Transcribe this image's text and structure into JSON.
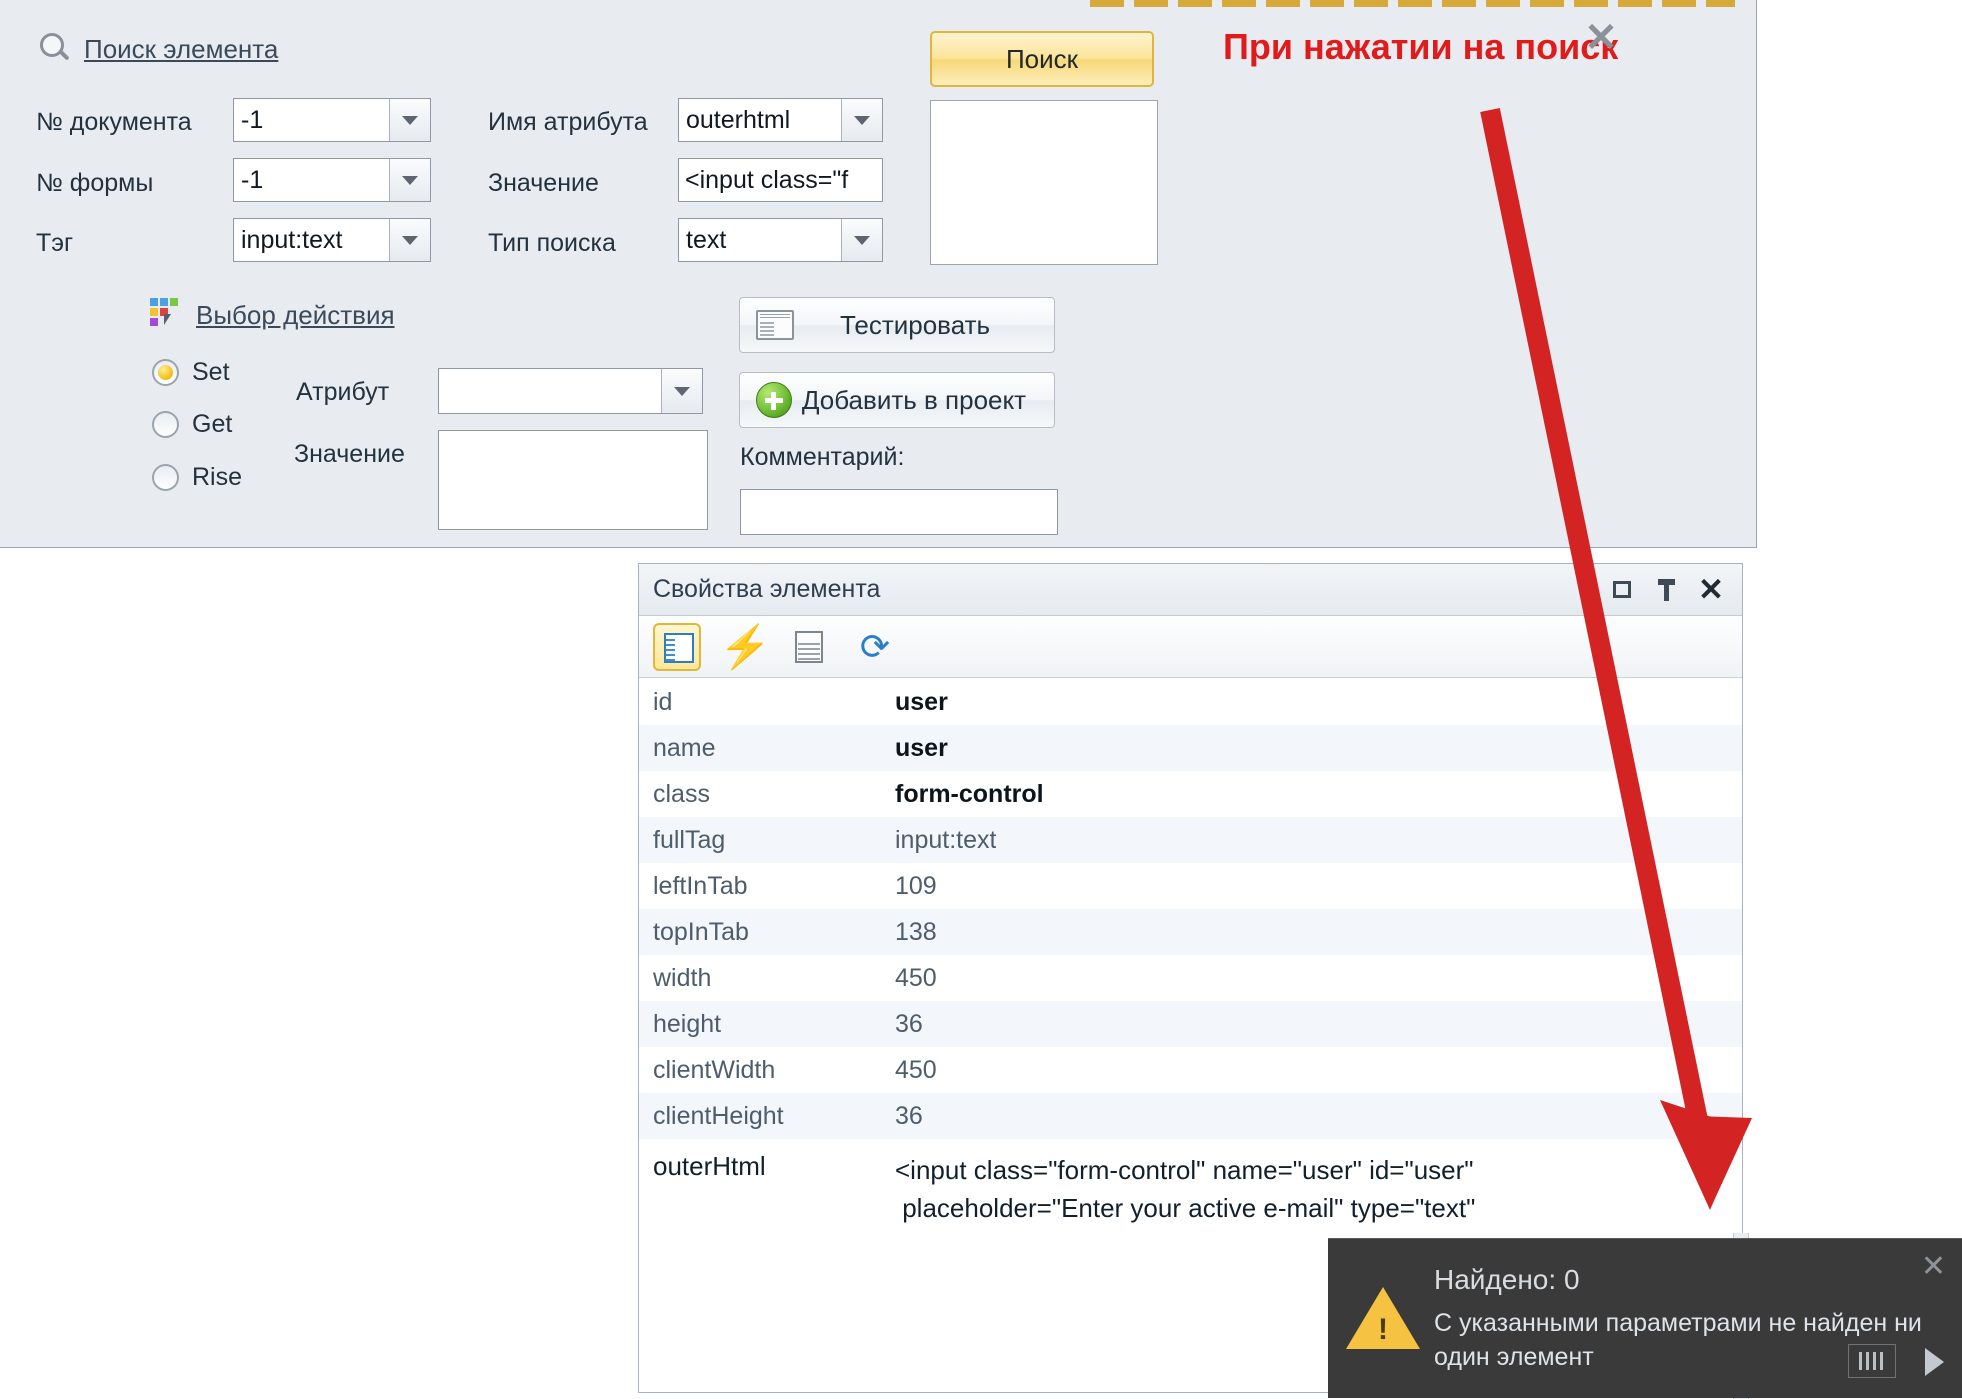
{
  "search_panel": {
    "title_link": "Поиск элемента",
    "search_icon": "magnifier-icon",
    "fields_left": [
      {
        "label": "№ документа",
        "value": "-1"
      },
      {
        "label": "№ формы",
        "value": "-1"
      },
      {
        "label": "Тэг",
        "value": "input:text"
      }
    ],
    "fields_mid": [
      {
        "label": "Имя атрибута",
        "value": "outerhtml",
        "type": "combo"
      },
      {
        "label": "Значение",
        "value": "<input class=\"f",
        "type": "text"
      },
      {
        "label": "Тип поиска",
        "value": "text",
        "type": "combo"
      }
    ],
    "search_button": "Поиск",
    "results_box_value": "",
    "action_link": "Выбор действия",
    "action_icon": "action-chooser-icon",
    "radios": [
      {
        "label": "Set",
        "selected": true
      },
      {
        "label": "Get",
        "selected": false
      },
      {
        "label": "Rise",
        "selected": false
      }
    ],
    "attribute_label": "Атрибут",
    "attribute_value": "",
    "value_label": "Значение",
    "value_value": "",
    "test_button": "Тестировать",
    "add_button": "Добавить в проект",
    "comment_label": "Комментарий:",
    "comment_value": ""
  },
  "annotation": {
    "text": "При нажатии на поиск",
    "color": "#e01b1b",
    "close_icon": "close-x-icon",
    "arrow": "red-arrow-pointing-down-right"
  },
  "properties_panel": {
    "title": "Свойства элемента",
    "window_buttons": [
      "restore-icon",
      "pin-icon",
      "close-icon"
    ],
    "toolbar_icons": [
      "properties-view-icon",
      "events-lightning-icon",
      "list-view-icon",
      "refresh-icon"
    ],
    "rows": [
      {
        "key": "id",
        "value": "user",
        "style": "bold"
      },
      {
        "key": "name",
        "value": "user",
        "style": "bold"
      },
      {
        "key": "class",
        "value": "form-control",
        "style": "bold"
      },
      {
        "key": "fullTag",
        "value": "input:text",
        "style": "dim"
      },
      {
        "key": "leftInTab",
        "value": "109",
        "style": "dim"
      },
      {
        "key": "topInTab",
        "value": "138",
        "style": "dim"
      },
      {
        "key": "width",
        "value": "450",
        "style": "dim"
      },
      {
        "key": "height",
        "value": "36",
        "style": "dim"
      },
      {
        "key": "clientWidth",
        "value": "450",
        "style": "dim"
      },
      {
        "key": "clientHeight",
        "value": "36",
        "style": "dim"
      }
    ],
    "outerhtml": {
      "key": "outerHtml",
      "value": "<input class=\"form-control\" name=\"user\" id=\"user\"\n placeholder=\"Enter your active e-mail\" type=\"text\""
    }
  },
  "toast": {
    "icon": "warning-triangle-icon",
    "title": "Найдено: 0",
    "message": "С указанными параметрами не\nнайден ни один элемент",
    "close_icon": "close-x-icon",
    "grip_icon": "resize-grip-icon",
    "next_icon": "next-arrow-icon"
  }
}
